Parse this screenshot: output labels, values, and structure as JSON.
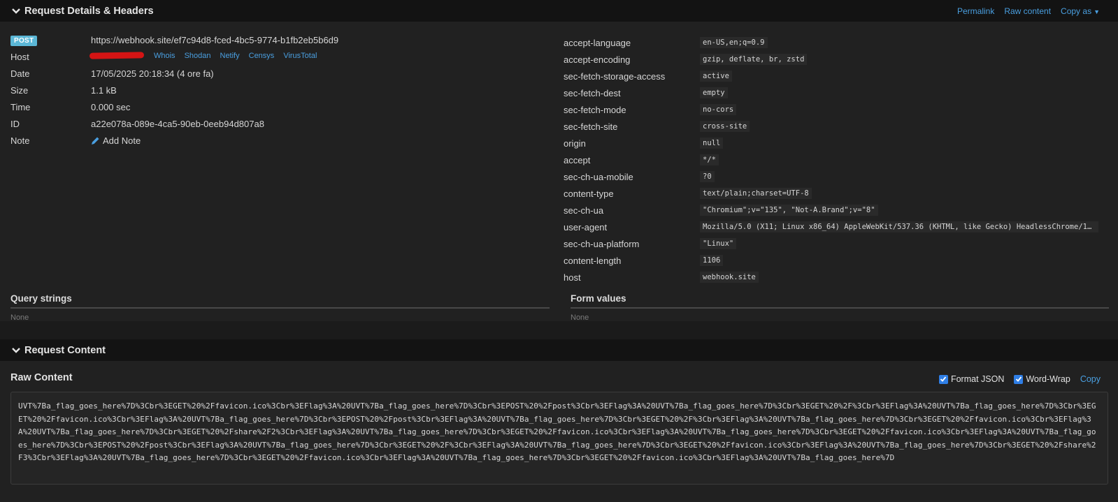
{
  "section1": {
    "title": "Request Details & Headers",
    "actions": [
      "Permalink",
      "Raw content",
      "Copy as"
    ]
  },
  "details": {
    "method": "POST",
    "url": "https://webhook.site/ef7c94d8-fced-4bc5-9774-b1fb2eb5b6d9",
    "host_label": "Host",
    "host_links": [
      "Whois",
      "Shodan",
      "Netify",
      "Censys",
      "VirusTotal"
    ],
    "date_label": "Date",
    "date": "17/05/2025 20:18:34 (4 ore fa)",
    "size_label": "Size",
    "size": "1.1 kB",
    "time_label": "Time",
    "time": "0.000 sec",
    "id_label": "ID",
    "id": "a22e078a-089e-4ca5-90eb-0eeb94d807a8",
    "note_label": "Note",
    "add_note": "Add Note"
  },
  "headers": [
    {
      "k": "accept-language",
      "v": "en-US,en;q=0.9"
    },
    {
      "k": "accept-encoding",
      "v": "gzip, deflate, br, zstd"
    },
    {
      "k": "sec-fetch-storage-access",
      "v": "active"
    },
    {
      "k": "sec-fetch-dest",
      "v": "empty"
    },
    {
      "k": "sec-fetch-mode",
      "v": "no-cors"
    },
    {
      "k": "sec-fetch-site",
      "v": "cross-site"
    },
    {
      "k": "origin",
      "v": "null"
    },
    {
      "k": "accept",
      "v": "*/*"
    },
    {
      "k": "sec-ch-ua-mobile",
      "v": "?0"
    },
    {
      "k": "content-type",
      "v": "text/plain;charset=UTF-8"
    },
    {
      "k": "sec-ch-ua",
      "v": "\"Chromium\";v=\"135\", \"Not-A.Brand\";v=\"8\""
    },
    {
      "k": "user-agent",
      "v": "Mozilla/5.0 (X11; Linux x86_64) AppleWebKit/537.36 (KHTML, like Gecko) HeadlessChrome/135..."
    },
    {
      "k": "sec-ch-ua-platform",
      "v": "\"Linux\""
    },
    {
      "k": "content-length",
      "v": "1106"
    },
    {
      "k": "host",
      "v": "webhook.site"
    }
  ],
  "query": {
    "title": "Query strings",
    "value": "None"
  },
  "form": {
    "title": "Form values",
    "value": "None"
  },
  "section2": {
    "title": "Request Content"
  },
  "raw": {
    "title": "Raw Content",
    "format_json": "Format JSON",
    "word_wrap": "Word-Wrap",
    "copy": "Copy",
    "content": "UVT%7Ba_flag_goes_here%7D%3Cbr%3EGET%20%2Ffavicon.ico%3Cbr%3EFlag%3A%20UVT%7Ba_flag_goes_here%7D%3Cbr%3EPOST%20%2Fpost%3Cbr%3EFlag%3A%20UVT%7Ba_flag_goes_here%7D%3Cbr%3EGET%20%2F%3Cbr%3EFlag%3A%20UVT%7Ba_flag_goes_here%7D%3Cbr%3EGET%20%2Ffavicon.ico%3Cbr%3EFlag%3A%20UVT%7Ba_flag_goes_here%7D%3Cbr%3EPOST%20%2Fpost%3Cbr%3EFlag%3A%20UVT%7Ba_flag_goes_here%7D%3Cbr%3EGET%20%2F%3Cbr%3EFlag%3A%20UVT%7Ba_flag_goes_here%7D%3Cbr%3EGET%20%2Ffavicon.ico%3Cbr%3EFlag%3A%20UVT%7Ba_flag_goes_here%7D%3Cbr%3EGET%20%2Fshare%2F2%3Cbr%3EFlag%3A%20UVT%7Ba_flag_goes_here%7D%3Cbr%3EGET%20%2Ffavicon.ico%3Cbr%3EFlag%3A%20UVT%7Ba_flag_goes_here%7D%3Cbr%3EGET%20%2Ffavicon.ico%3Cbr%3EFlag%3A%20UVT%7Ba_flag_goes_here%7D%3Cbr%3EPOST%20%2Fpost%3Cbr%3EFlag%3A%20UVT%7Ba_flag_goes_here%7D%3Cbr%3EGET%20%2F%3Cbr%3EFlag%3A%20UVT%7Ba_flag_goes_here%7D%3Cbr%3EGET%20%2Ffavicon.ico%3Cbr%3EFlag%3A%20UVT%7Ba_flag_goes_here%7D%3Cbr%3EGET%20%2Fshare%2F3%3Cbr%3EFlag%3A%20UVT%7Ba_flag_goes_here%7D%3Cbr%3EGET%20%2Ffavicon.ico%3Cbr%3EFlag%3A%20UVT%7Ba_flag_goes_here%7D%3Cbr%3EGET%20%2Ffavicon.ico%3Cbr%3EFlag%3A%20UVT%7Ba_flag_goes_here%7D"
  },
  "colors": {
    "link": "#4a9fe0",
    "badge": "#5bb7d6",
    "checkbox": "#2f7ee5",
    "redaction": "#d41414"
  }
}
